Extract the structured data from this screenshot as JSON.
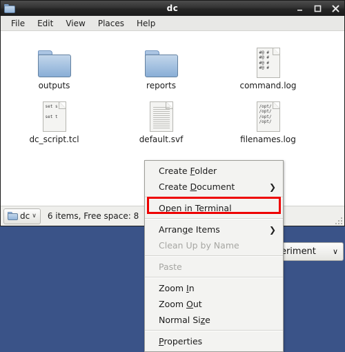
{
  "window": {
    "title": "dc",
    "icon": "folder-icon",
    "controls": {
      "minimize": "minimize-icon",
      "maximize": "maximize-icon",
      "close": "close-icon"
    }
  },
  "menubar": {
    "items": [
      {
        "label": "File"
      },
      {
        "label": "Edit"
      },
      {
        "label": "View"
      },
      {
        "label": "Places"
      },
      {
        "label": "Help"
      }
    ]
  },
  "files": [
    {
      "name": "outputs",
      "type": "folder",
      "icon": "folder-icon",
      "preview": ""
    },
    {
      "name": "reports",
      "type": "folder",
      "icon": "folder-icon",
      "preview": ""
    },
    {
      "name": "command.log",
      "type": "text",
      "icon": "text-file-icon",
      "preview": "#@ #\n#@ #\n#@ #\n#@ #"
    },
    {
      "name": "dc_script.tcl",
      "type": "text",
      "icon": "script-file-icon",
      "preview": "set s\n\nset t"
    },
    {
      "name": "default.svf",
      "type": "document",
      "icon": "document-file-icon",
      "preview": ""
    },
    {
      "name": "filenames.log",
      "type": "text",
      "icon": "text-file-icon",
      "preview": "/opt/\n/opt/\n/opt/\n/opt/"
    }
  ],
  "statusbar": {
    "path_label": "dc",
    "path_icon": "folder-icon",
    "path_caret": "∨",
    "status_text": "6 items, Free space: 8"
  },
  "desktop": {
    "background_color": "#3a5388",
    "experiment_select": {
      "value": "xperiment",
      "caret": "∨"
    }
  },
  "context_menu": {
    "highlight_color": "#ee0000",
    "items": [
      {
        "label": "Create Folder",
        "mnemonic": "F",
        "pre": "Create ",
        "post": "older",
        "submenu": false,
        "disabled": false,
        "separator_after": false
      },
      {
        "label": "Create Document",
        "mnemonic": "D",
        "pre": "Create ",
        "post": "ocument",
        "submenu": true,
        "disabled": false,
        "separator_after": true
      },
      {
        "label": "Open in Terminal",
        "mnemonic": "",
        "pre": "Open in Terminal",
        "post": "",
        "submenu": false,
        "disabled": false,
        "separator_after": true,
        "highlighted": true
      },
      {
        "label": "Arrange Items",
        "mnemonic": "g",
        "pre": "Arran",
        "post": "e Items",
        "submenu": true,
        "disabled": false,
        "separator_after": false
      },
      {
        "label": "Clean Up by Name",
        "mnemonic": "",
        "pre": "Clean Up by Name",
        "post": "",
        "submenu": false,
        "disabled": true,
        "separator_after": true
      },
      {
        "label": "Paste",
        "mnemonic": "",
        "pre": "Paste",
        "post": "",
        "submenu": false,
        "disabled": true,
        "separator_after": true
      },
      {
        "label": "Zoom In",
        "mnemonic": "I",
        "pre": "Zoom ",
        "post": "n",
        "submenu": false,
        "disabled": false,
        "separator_after": false
      },
      {
        "label": "Zoom Out",
        "mnemonic": "O",
        "pre": "Zoom ",
        "post": "ut",
        "submenu": false,
        "disabled": false,
        "separator_after": false
      },
      {
        "label": "Normal Size",
        "mnemonic": "z",
        "pre": "Normal Si",
        "post": "e",
        "submenu": false,
        "disabled": false,
        "separator_after": true
      },
      {
        "label": "Properties",
        "mnemonic": "P",
        "pre": "",
        "post": "roperties",
        "submenu": false,
        "disabled": false,
        "separator_after": false
      }
    ]
  }
}
